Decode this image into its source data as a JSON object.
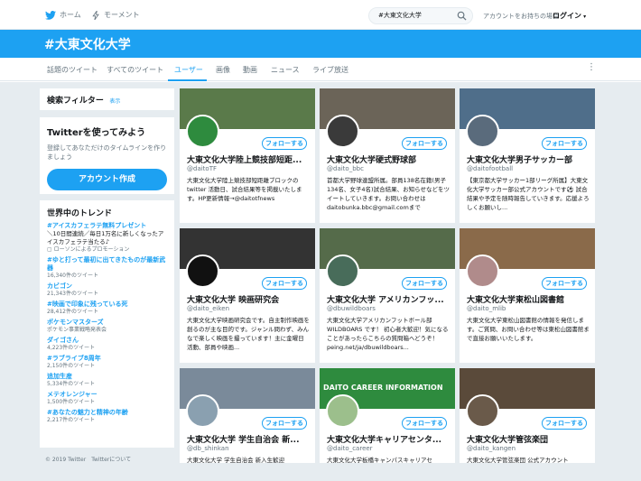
{
  "topnav": {
    "home_label": "ホーム",
    "moments_label": "モーメント",
    "search_value": "#大東文化大学",
    "login_prompt": "アカウントをお持ちの場合",
    "login_label": "ログイン"
  },
  "banner": {
    "title": "#大東文化大学"
  },
  "tabs": [
    "話題のツイート",
    "すべてのツイート",
    "ユーザー",
    "画像",
    "動画",
    "ニュース",
    "ライブ放送"
  ],
  "active_tab": "ユーザー",
  "sidebar": {
    "filter_title": "検索フィルター",
    "filter_show": "表示",
    "use_title": "Twitterを使ってみよう",
    "use_text": "登録してあなただけのタイムラインを作りましょう",
    "create_button": "アカウント作成",
    "trends_title": "世界中のトレンド",
    "trends": [
      {
        "name": "#アイスカフェラテ無料プレゼント",
        "desc": "＼10日間連続／毎日1万名に新しくなったアイスカフェラテ当たる♪",
        "promo": "ローソンによるプロモーション"
      },
      {
        "name": "#ゆと打って最初に出てきたものが最新武器",
        "count": "16,340件のツイート"
      },
      {
        "name": "カビゴン",
        "count": "21,343件のツイート"
      },
      {
        "name": "#映画で印象に残っている死",
        "count": "28,412件のツイート"
      },
      {
        "name": "ポケモンマスターズ",
        "count": "ポケモン事業戦略発表会"
      },
      {
        "name": "ダイゴさん",
        "count": "4,223件のツイート"
      },
      {
        "name": "#ラブライブ8周年",
        "count": "2,150件のツイート"
      },
      {
        "name": "追加生産",
        "count": "5,334件のツイート"
      },
      {
        "name": "メテオレンジャー",
        "count": "1,500件のツイート"
      },
      {
        "name": "#あなたの魅力と精神の年齢",
        "count": "2,217件のツイート"
      }
    ],
    "footer": "© 2019 Twitter　Twitterについて"
  },
  "follow_label": "フォローする",
  "cards": [
    {
      "name": "大東文化大学陸上競技部短距...",
      "handle": "@daitoTF",
      "bio": "大東文化大学陸上競技部短距離ブロックのtwitter 活動日、試合結果等を掲載いたします。HP更新情報→@daitotfnews",
      "banner_color": "#5a7a4a",
      "avatar_color": "#2e8b3e"
    },
    {
      "name": "大東文化大学硬式野球部",
      "handle": "@daito_bbc",
      "bio": "首都大学野球連盟所属。部員138名在籍(男子134名、女子4名)試合結果、お知らせなどをツイートしていきます。お問い合わせはdaitobunka.bbc@gmail.comまで",
      "banner_color": "#6b6458",
      "avatar_color": "#3a3a3a"
    },
    {
      "name": "大東文化大学男子サッカー部",
      "handle": "@daitofootball",
      "bio": "【東京都大学サッカー1部リーグ所属】大東文化大学サッカー部公式アカウントです⚽ 試合結果や予定を随時報告していきます。応援よろしくお願いし...",
      "banner_color": "#4f6e8a",
      "avatar_color": "#5a6b7c"
    },
    {
      "name": "大東文化大学 映画研究会",
      "handle": "@daito_eiken",
      "bio": "大東文化大学映画研究会です。自主制作映画を創るのが主な目的です。ジャンル問わず、みんなで楽しく映画を撮っています！主に金曜日活動、部員や映画...",
      "banner_color": "#333333",
      "avatar_color": "#111111"
    },
    {
      "name": "大東文化大学 アメリカンフッ...",
      "handle": "@dbuwildboars",
      "bio": "大東文化大学アメリカンフットボール部WILDBOARS です！ 初心者大歓迎！気になることがあったらこちらの質問箱へどうぞ！ peing.net/ja/dbuwildboars...",
      "banner_color": "#556b4a",
      "avatar_color": "#486c5a"
    },
    {
      "name": "大東文化大学東松山図書館",
      "handle": "@daito_mlib",
      "bio": "大東文化大学東松山図書館の情報を発信します。ご質問、お問い合わせ等は東松山図書館まで直接お願いいたします。",
      "banner_color": "#8a6a4a",
      "avatar_color": "#b08b8b"
    },
    {
      "name": "大東文化大学 学生自治会 新...",
      "handle": "@db_shinkan",
      "bio": "大東文化大学 学生自治会 新入生歓迎",
      "banner_color": "#7a8a9a",
      "avatar_color": "#8aa0b0"
    },
    {
      "name": "大東文化大学キャリアセンタ...",
      "handle": "@daito_career",
      "bio": "大東文化大学板橋キャンパスキャリアセ",
      "banner_color": "#2e8b3e",
      "avatar_color": "#9cbf8c",
      "banner_text": "DAITO CAREER INFORMATION"
    },
    {
      "name": "大東文化大学管弦楽団",
      "handle": "@daito_kangen",
      "bio": "大東文化大学管弦楽団 公式アカウント",
      "banner_color": "#5a4a3a",
      "avatar_color": "#6a5a4a"
    }
  ]
}
